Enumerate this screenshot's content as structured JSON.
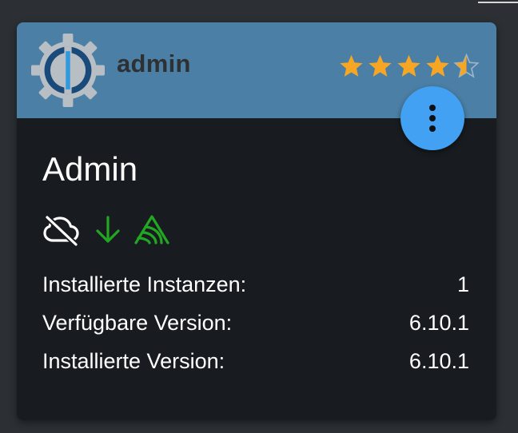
{
  "adapter": {
    "name": "admin",
    "title": "Admin",
    "rating": {
      "value": 4.5,
      "max": 5,
      "star_color": "#f6a623",
      "empty_star_color": "#9ab6cc"
    },
    "menu_icon": "more-vert-icon",
    "status_icons": [
      {
        "name": "cloud-off-icon",
        "color": "#ffffff"
      },
      {
        "name": "arrow-down-icon",
        "color": "#22a722"
      },
      {
        "name": "sentry-icon",
        "color": "#22a722"
      }
    ],
    "info": [
      {
        "label": "Installierte Instanzen:",
        "value": "1"
      },
      {
        "label": "Verfügbare Version:",
        "value": "6.10.1"
      },
      {
        "label": "Installierte Version:",
        "value": "6.10.1"
      }
    ]
  },
  "colors": {
    "header_bg": "#4c7fa5",
    "card_bg": "#181c20",
    "page_bg": "#2c3034",
    "accent": "#42a1f2"
  }
}
